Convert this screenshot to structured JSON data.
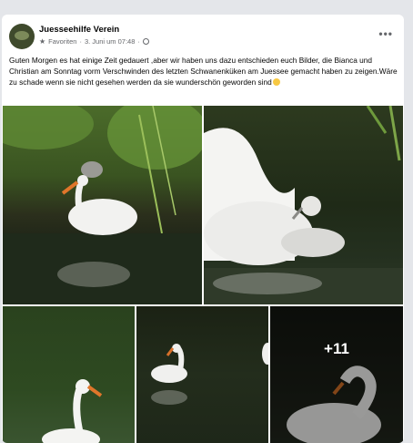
{
  "post": {
    "page_name": "Juesseehilfe Verein",
    "favorites_label": "Favoriten",
    "date": "3. Juni um 07:48",
    "separator": "·",
    "more_label": "•••",
    "text": "Guten Morgen es hat einige Zeit gedauert ,aber wir haben uns dazu entschieden euch Bilder, die Bianca und Christian am Sonntag vorm Verschwinden des letzten Schwanenküken am Juessee gemacht haben zu zeigen.Wäre zu schade wenn sie nicht gesehen werden da sie wunderschön geworden sind",
    "more_photos_count": "+11"
  },
  "colors": {
    "background": "#e4e6ea",
    "card": "#ffffff",
    "secondary_text": "#65676b"
  },
  "icons": [
    "star-icon",
    "globe-icon",
    "more-options-icon",
    "laughing-emoji-icon"
  ]
}
